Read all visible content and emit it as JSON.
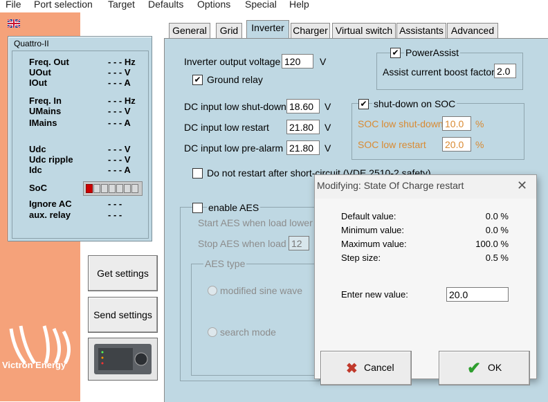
{
  "menu": [
    "File",
    "Port selection",
    "Target",
    "Defaults",
    "Options",
    "Special",
    "Help"
  ],
  "status": {
    "title": "Quattro-II",
    "rows": [
      {
        "label": "Freq. Out",
        "value": "- - - Hz"
      },
      {
        "label": "UOut",
        "value": "- - - V"
      },
      {
        "label": "IOut",
        "value": "- - - A"
      },
      {
        "label": "Freq. In",
        "value": "- - - Hz"
      },
      {
        "label": "UMains",
        "value": "- - - V"
      },
      {
        "label": "IMains",
        "value": "- - - A"
      },
      {
        "label": "Udc",
        "value": "- - - V"
      },
      {
        "label": "Udc ripple",
        "value": "- - - V"
      },
      {
        "label": "Idc",
        "value": "- - - A"
      },
      {
        "label": "SoC",
        "value": ""
      },
      {
        "label": "Ignore AC",
        "value": "- - -"
      },
      {
        "label": "aux. relay",
        "value": "- - -"
      }
    ]
  },
  "buttons": {
    "get": "Get settings",
    "send": "Send settings"
  },
  "logo": {
    "text": "Victron Energy"
  },
  "tabs": [
    "General",
    "Grid",
    "Inverter",
    "Charger",
    "Virtual switch",
    "Assistants",
    "Advanced"
  ],
  "inverter": {
    "output_voltage_label": "Inverter output voltage",
    "output_voltage": "120",
    "v_unit": "V",
    "ground_relay": "Ground relay",
    "dc_shutdown_label": "DC input low shut-down",
    "dc_shutdown": "18.60",
    "dc_restart_label": "DC input low restart",
    "dc_restart": "21.80",
    "dc_prealarm_label": "DC input low pre-alarm",
    "dc_prealarm": "21.80",
    "no_restart": "Do not restart after short-circuit (VDE 2510-2  safety)",
    "enable_aes": "enable AES",
    "start_aes": "Start AES when load lower t",
    "stop_aes": "Stop AES when load",
    "stop_aes_value": "12",
    "aes_type": "AES type",
    "modified_sine": "modified sine wave",
    "search_mode": "search mode",
    "powerassist": "PowerAssist",
    "boost_label": "Assist current boost factor",
    "boost_value": "2.0",
    "soc_shutdown_group": "shut-down on SOC",
    "soc_low_shutdown_label": "SOC low shut-down",
    "soc_low_shutdown": "10.0",
    "soc_low_restart_label": "SOC low restart",
    "soc_low_restart": "20.0",
    "pct": "%"
  },
  "dialog": {
    "title": "Modifying: State Of Charge restart",
    "default_label": "Default value:",
    "default_value": "0.0 %",
    "min_label": "Minimum value:",
    "min_value": "0.0 %",
    "max_label": "Maximum value:",
    "max_value": "100.0 %",
    "step_label": "Step size:",
    "step_value": "0.5 %",
    "enter_label": "Enter new value:",
    "enter_value": "20.0",
    "cancel": "Cancel",
    "ok": "OK"
  },
  "colors": {
    "panel": "#bfd8e3",
    "sidebar": "#f5a27a",
    "soc_fill": "#cc0000",
    "orange_text": "#d98a32"
  }
}
